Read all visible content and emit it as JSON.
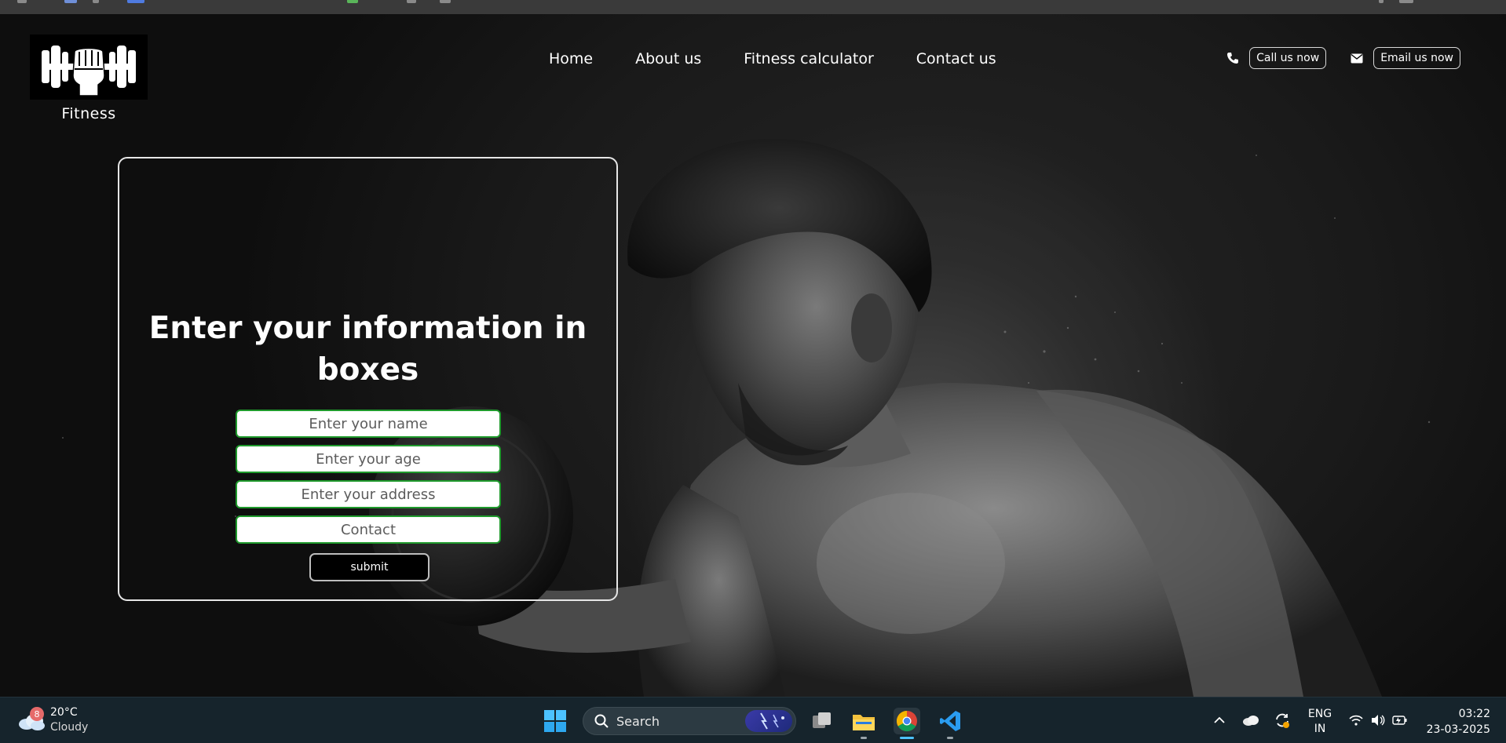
{
  "brand": {
    "name": "Fitness",
    "logo_icon": "dumbbell-fist-logo"
  },
  "nav": {
    "items": [
      "Home",
      "About us",
      "Fitness calculator",
      "Contact us"
    ]
  },
  "contact": {
    "call_label": "Call us now",
    "email_label": "Email us now",
    "call_icon": "phone-icon",
    "email_icon": "mail-icon"
  },
  "form": {
    "title": "Enter your information in boxes",
    "fields": [
      {
        "placeholder": "Enter your name",
        "value": ""
      },
      {
        "placeholder": "Enter your age",
        "value": ""
      },
      {
        "placeholder": "Enter your address",
        "value": ""
      },
      {
        "placeholder": "Contact",
        "value": ""
      }
    ],
    "submit_label": "submit",
    "field_border_color": "#1f9a2c"
  },
  "taskbar": {
    "weather": {
      "temperature": "20°C",
      "condition": "Cloudy",
      "badge_count": "8"
    },
    "search_label": "Search",
    "apps": [
      "windows-start-icon",
      "task-view-icon",
      "file-explorer-icon",
      "chrome-icon",
      "vscode-icon"
    ],
    "language": {
      "line1": "ENG",
      "line2": "IN"
    },
    "time": "03:22",
    "date": "23-03-2025"
  },
  "colors": {
    "taskbar_bg": "#16242c",
    "accent_green": "#1f9a2c"
  }
}
